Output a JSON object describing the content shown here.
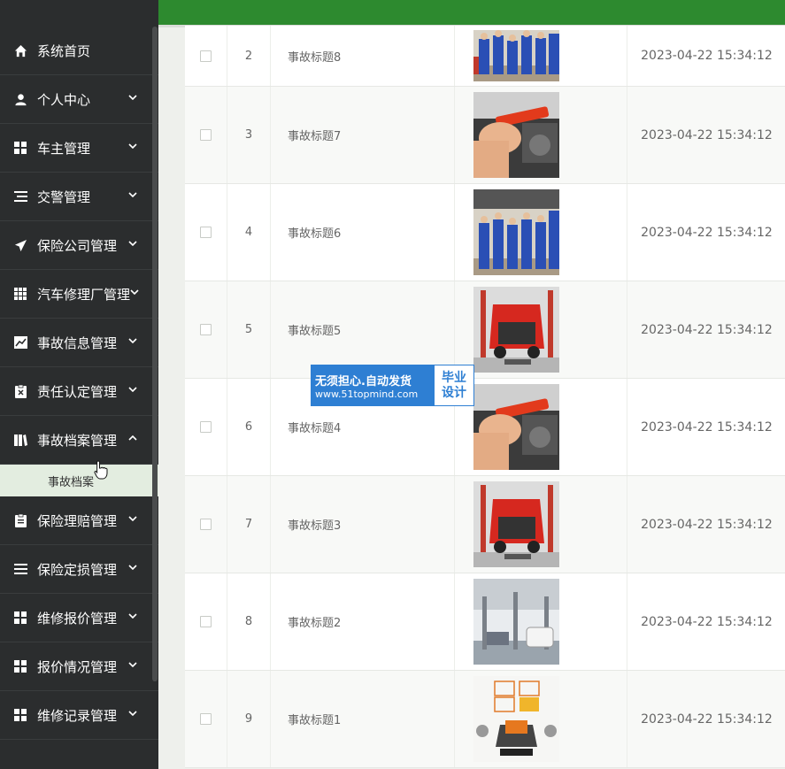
{
  "sidebar": {
    "items": [
      {
        "label": "系统首页",
        "icon": "home-icon",
        "has_chevron": false
      },
      {
        "label": "个人中心",
        "icon": "person-icon",
        "has_chevron": true
      },
      {
        "label": "车主管理",
        "icon": "grid-icon",
        "has_chevron": true
      },
      {
        "label": "交警管理",
        "icon": "list-icon",
        "has_chevron": true
      },
      {
        "label": "保险公司管理",
        "icon": "send-icon",
        "has_chevron": true
      },
      {
        "label": "汽车修理厂管理",
        "icon": "table-icon",
        "has_chevron": true
      },
      {
        "label": "事故信息管理",
        "icon": "chart-icon",
        "has_chevron": true
      },
      {
        "label": "责任认定管理",
        "icon": "clipboard-x-icon",
        "has_chevron": true
      },
      {
        "label": "事故档案管理",
        "icon": "book-icon",
        "has_chevron": true,
        "expanded": true
      }
    ],
    "submenu": [
      {
        "label": "事故档案"
      }
    ],
    "items_after": [
      {
        "label": "保险理赔管理",
        "icon": "clipboard-icon",
        "has_chevron": true
      },
      {
        "label": "保险定损管理",
        "icon": "list-icon",
        "has_chevron": true
      },
      {
        "label": "维修报价管理",
        "icon": "grid-icon",
        "has_chevron": true
      },
      {
        "label": "报价情况管理",
        "icon": "grid-icon",
        "has_chevron": true
      },
      {
        "label": "维修记录管理",
        "icon": "grid-icon",
        "has_chevron": true
      }
    ]
  },
  "colors": {
    "topbar": "#2d8a2f",
    "sidebar": "#2b2d2e",
    "submenu_bg": "#e3ede0",
    "watermark": "#2e7fd3"
  },
  "table": {
    "rows": [
      {
        "index": "2",
        "title": "事故标题8",
        "time": "2023-04-22 15:34:12",
        "image": "mechanics-group"
      },
      {
        "index": "3",
        "title": "事故标题7",
        "time": "2023-04-22 15:34:12",
        "image": "hand-wrench"
      },
      {
        "index": "4",
        "title": "事故标题6",
        "time": "2023-04-22 15:34:12",
        "image": "mechanics-group"
      },
      {
        "index": "5",
        "title": "事故标题5",
        "time": "2023-04-22 15:34:12",
        "image": "red-car-engine"
      },
      {
        "index": "6",
        "title": "事故标题4",
        "time": "2023-04-22 15:34:12",
        "image": "hand-wrench"
      },
      {
        "index": "7",
        "title": "事故标题3",
        "time": "2023-04-22 15:34:12",
        "image": "red-car-engine"
      },
      {
        "index": "8",
        "title": "事故标题2",
        "time": "2023-04-22 15:34:12",
        "image": "garage-interior"
      },
      {
        "index": "9",
        "title": "事故标题1",
        "time": "2023-04-22 15:34:12",
        "image": "repair-logo"
      }
    ]
  },
  "watermark": {
    "line1": "无须担心.自动发货",
    "line2": "www.51topmind.com",
    "right_top": "毕业",
    "right_bottom": "设计"
  }
}
